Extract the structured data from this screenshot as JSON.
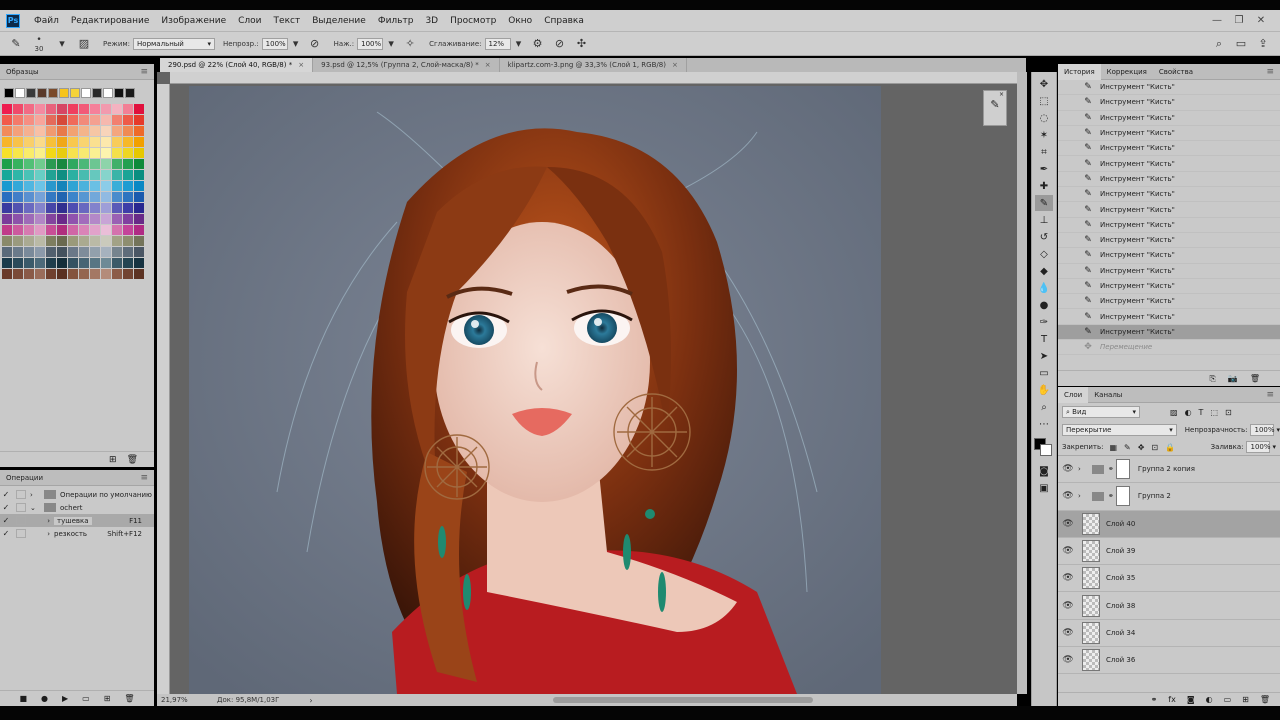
{
  "menu": {
    "items": [
      "Файл",
      "Редактирование",
      "Изображение",
      "Слои",
      "Текст",
      "Выделение",
      "Фильтр",
      "3D",
      "Просмотр",
      "Окно",
      "Справка"
    ]
  },
  "options": {
    "brush_size": "30",
    "mode_label": "Режим:",
    "mode_value": "Нормальный",
    "opacity_label": "Непрозр.:",
    "opacity_value": "100%",
    "pressure_label": "Наж.:",
    "pressure_value": "100%",
    "smoothing_label": "Сглаживание:",
    "smoothing_value": "12%"
  },
  "swatches": {
    "title": "Образцы",
    "top_row": [
      "#000000",
      "#ffffff",
      "#3a3a3a",
      "#5a3a2a",
      "#7a4a2a",
      "#f7c41b",
      "#f5d33a",
      "#ffffff",
      "#2a2a2a",
      "#ffffff",
      "#111111",
      "#1a1a1a"
    ],
    "rows": [
      [
        "#ee1d4f",
        "#f04a6a",
        "#f26a84",
        "#f48aa0",
        "#e8627c",
        "#d64664",
        "#ef3f5f",
        "#f25a78",
        "#f5809a",
        "#f29aae",
        "#f4b2c0",
        "#f27f95",
        "#e0103c"
      ],
      [
        "#f25a4b",
        "#f47a6a",
        "#f68e82",
        "#f8a59b",
        "#e46a5a",
        "#d64a3a",
        "#f06a5a",
        "#f28a7a",
        "#f4a090",
        "#f6b8ae",
        "#f28070",
        "#ee5a48",
        "#e63a2a"
      ],
      [
        "#f28a5a",
        "#f4a07a",
        "#f5b090",
        "#f8c0a6",
        "#f09a70",
        "#e87a4a",
        "#f2a272",
        "#f4b48a",
        "#f6c6a4",
        "#f8d4ba",
        "#f4a67e",
        "#f08a54",
        "#ee6a2a"
      ],
      [
        "#f7b52a",
        "#f8c24a",
        "#f9cf6a",
        "#fadb8a",
        "#f6c03a",
        "#f0a818",
        "#f8c84e",
        "#f9d470",
        "#fae090",
        "#fce8ac",
        "#f8cc5a",
        "#f6b828",
        "#f2a000"
      ],
      [
        "#f7e02a",
        "#f8e64a",
        "#f9ec6a",
        "#faf08a",
        "#f2d818",
        "#e8cc10",
        "#f6e24e",
        "#f8ea70",
        "#faf092",
        "#fcf4ae",
        "#f4e04a",
        "#eed622",
        "#e6c800"
      ],
      [
        "#1ea04a",
        "#36b25e",
        "#52c076",
        "#70cc8e",
        "#2a9a52",
        "#188840",
        "#30a860",
        "#4cb878",
        "#6cc692",
        "#8ed4aa",
        "#40b06a",
        "#22a050",
        "#0e8a3a"
      ],
      [
        "#17a89a",
        "#2eb6a8",
        "#4ac2b6",
        "#68cec4",
        "#22a294",
        "#108e82",
        "#2cb0a2",
        "#48bcb0",
        "#66c8be",
        "#86d4cc",
        "#3ab4a8",
        "#1aa496",
        "#0a8e80"
      ],
      [
        "#1a9ad0",
        "#34a8d8",
        "#50b6e0",
        "#6cc4e6",
        "#2a98cc",
        "#1684ba",
        "#30a4d4",
        "#4cb2dc",
        "#6ac0e4",
        "#8ccce8",
        "#3aaed8",
        "#1e9cd2",
        "#0a88c4"
      ],
      [
        "#2a6ec0",
        "#427ec8",
        "#5a90d0",
        "#76a2d8",
        "#3478c2",
        "#2264b0",
        "#3c84ca",
        "#5696d2",
        "#72a8da",
        "#90bae2",
        "#4a8ccc",
        "#2e74c0",
        "#1a5aae"
      ],
      [
        "#3a3aa0",
        "#5252b0",
        "#6a6ac0",
        "#8484cc",
        "#4646a8",
        "#303090",
        "#4e4eb2",
        "#6868c0",
        "#8282cc",
        "#9e9ed8",
        "#5a5ab8",
        "#3e3ea8",
        "#282890"
      ],
      [
        "#7a3a9a",
        "#8c52aa",
        "#9e6ab8",
        "#b286c6",
        "#84449e",
        "#6a2a8a",
        "#9052ae",
        "#a26cbc",
        "#b488c8",
        "#c8a4d6",
        "#9a60b4",
        "#8040a0",
        "#682a88"
      ],
      [
        "#c03a8a",
        "#cc5a9e",
        "#d67ab0",
        "#e09ac4",
        "#c84e96",
        "#b02e7e",
        "#d066a6",
        "#da84b8",
        "#e2a2ca",
        "#eabed8",
        "#d472ae",
        "#c4449a",
        "#b02a84"
      ],
      [
        "#8a8a6a",
        "#9a9a7e",
        "#aaaa92",
        "#baba a6",
        "#7e7e60",
        "#6a6a50",
        "#9a9a7a",
        "#aaaa90",
        "#babaa6",
        "#cacabc",
        "#a2a286",
        "#8e8e70",
        "#74745a"
      ],
      [
        "#5a6a7a",
        "#6a7a8a",
        "#7a8a9a",
        "#8c9aaa",
        "#52606e",
        "#44525e",
        "#6a7888",
        "#7e8c9a",
        "#92a0ac",
        "#a6b2be",
        "#76848e",
        "#5e6c7a",
        "#4a5664"
      ],
      [
        "#1a3a4a",
        "#2a4a5a",
        "#3a5a6a",
        "#4c6a7a",
        "#203e4c",
        "#142e3a",
        "#345262",
        "#466474",
        "#587684",
        "#6e8a96",
        "#3c5a68",
        "#244452",
        "#163240"
      ],
      [
        "#6a3a2a",
        "#7a4a38",
        "#8a5a48",
        "#9a6c5a",
        "#70402e",
        "#5a3020",
        "#84543e",
        "#946650",
        "#a47864",
        "#b48c7a",
        "#8c5c48",
        "#724432",
        "#5c3222"
      ]
    ]
  },
  "actions": {
    "title": "Операции",
    "items": [
      {
        "label": "Операции по умолчанию",
        "shortcut": ""
      },
      {
        "label": "ochert",
        "shortcut": ""
      },
      {
        "label": "тушевка",
        "shortcut": "F11"
      },
      {
        "label": "резкость",
        "shortcut": "Shift+F12"
      }
    ]
  },
  "documents": {
    "tabs": [
      {
        "label": "290.psd @ 22% (Слой 40, RGB/8) *",
        "active": true
      },
      {
        "label": "93.psd @ 12,5% (Группа 2, Слой-маска/8) *",
        "active": false
      },
      {
        "label": "klipartz.com-3.png @ 33,3% (Слой 1, RGB/8)",
        "active": false
      }
    ]
  },
  "status": {
    "zoom": "21,97%",
    "doc": "Док: 95,8M/1,03Г"
  },
  "history": {
    "tabs": [
      "История",
      "Коррекция",
      "Свойства"
    ],
    "item_label": "Инструмент \"Кисть\"",
    "count": 17,
    "dim_label": "Перемещение"
  },
  "layers": {
    "tabs": [
      "Слои",
      "Каналы"
    ],
    "filter": "Вид",
    "blend": "Перекрытие",
    "opacity_label": "Непрозрачность:",
    "opacity_value": "100%",
    "lock_label": "Закрепить:",
    "fill_label": "Заливка:",
    "fill_value": "100%",
    "items": [
      {
        "name": "Группа 2 копия",
        "group": true,
        "selected": false
      },
      {
        "name": "Группа 2",
        "group": true,
        "selected": false
      },
      {
        "name": "Слой 40",
        "group": false,
        "selected": true
      },
      {
        "name": "Слой 39",
        "group": false,
        "selected": false
      },
      {
        "name": "Слой 35",
        "group": false,
        "selected": false
      },
      {
        "name": "Слой 38",
        "group": false,
        "selected": false
      },
      {
        "name": "Слой 34",
        "group": false,
        "selected": false
      },
      {
        "name": "Слой 36",
        "group": false,
        "selected": false
      }
    ]
  },
  "colors": {
    "canvas_bg": "#6b7585",
    "hair": "#8a3a14",
    "skin": "#efd2c8",
    "sweater": "#b81c20"
  }
}
